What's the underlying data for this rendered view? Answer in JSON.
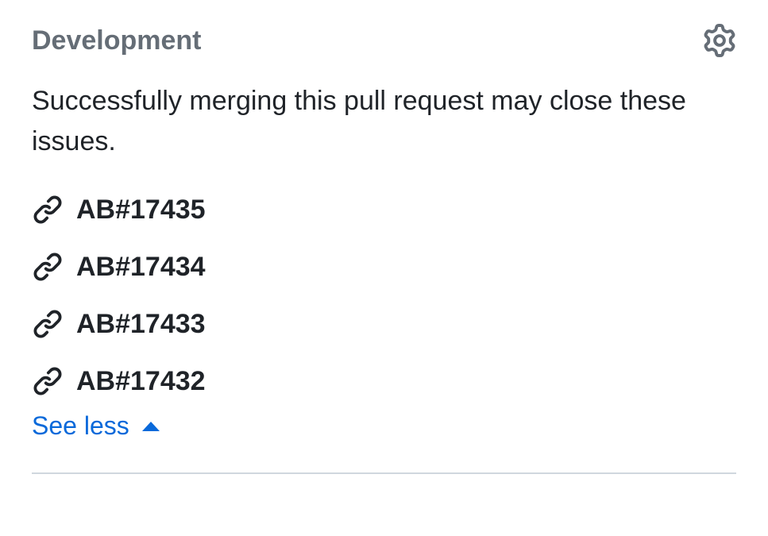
{
  "section": {
    "title": "Development",
    "description": "Successfully merging this pull request may close these issues."
  },
  "issues": [
    {
      "label": "AB#17435"
    },
    {
      "label": "AB#17434"
    },
    {
      "label": "AB#17433"
    },
    {
      "label": "AB#17432"
    }
  ],
  "toggle": {
    "label": "See less"
  }
}
